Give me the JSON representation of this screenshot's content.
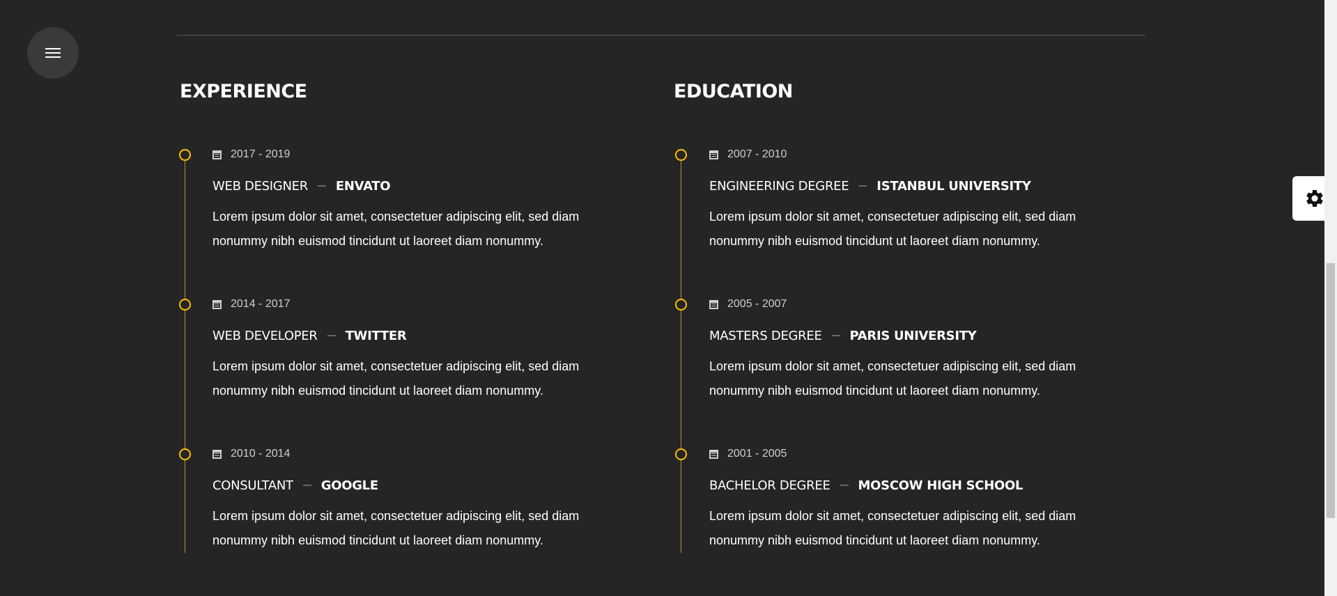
{
  "colors": {
    "background": "#252525",
    "accent": "#ffbf00",
    "text": "#ffffff",
    "muted": "#cfcfcf"
  },
  "icons": {
    "menu": "hamburger-icon",
    "settings": "gear-icon",
    "date": "calendar-icon"
  },
  "experience": {
    "title": "EXPERIENCE",
    "items": [
      {
        "date": "2017 - 2019",
        "role": "WEB DESIGNER",
        "org": "ENVATO",
        "desc": "Lorem ipsum dolor sit amet, consectetuer adipiscing elit, sed diam nonummy nibh euismod tincidunt ut laoreet diam nonummy."
      },
      {
        "date": "2014 - 2017",
        "role": "WEB DEVELOPER",
        "org": "TWITTER",
        "desc": "Lorem ipsum dolor sit amet, consectetuer adipiscing elit, sed diam nonummy nibh euismod tincidunt ut laoreet diam nonummy."
      },
      {
        "date": "2010 - 2014",
        "role": "CONSULTANT",
        "org": "GOOGLE",
        "desc": "Lorem ipsum dolor sit amet, consectetuer adipiscing elit, sed diam nonummy nibh euismod tincidunt ut laoreet diam nonummy."
      }
    ]
  },
  "education": {
    "title": "EDUCATION",
    "items": [
      {
        "date": "2007 - 2010",
        "role": "ENGINEERING DEGREE",
        "org": "ISTANBUL UNIVERSITY",
        "desc": "Lorem ipsum dolor sit amet, consectetuer adipiscing elit, sed diam nonummy nibh euismod tincidunt ut laoreet diam nonummy."
      },
      {
        "date": "2005 - 2007",
        "role": "MASTERS DEGREE",
        "org": "PARIS UNIVERSITY",
        "desc": "Lorem ipsum dolor sit amet, consectetuer adipiscing elit, sed diam nonummy nibh euismod tincidunt ut laoreet diam nonummy."
      },
      {
        "date": "2001 - 2005",
        "role": "BACHELOR DEGREE",
        "org": "MOSCOW HIGH SCHOOL",
        "desc": "Lorem ipsum dolor sit amet, consectetuer adipiscing elit, sed diam nonummy nibh euismod tincidunt ut laoreet diam nonummy."
      }
    ]
  }
}
